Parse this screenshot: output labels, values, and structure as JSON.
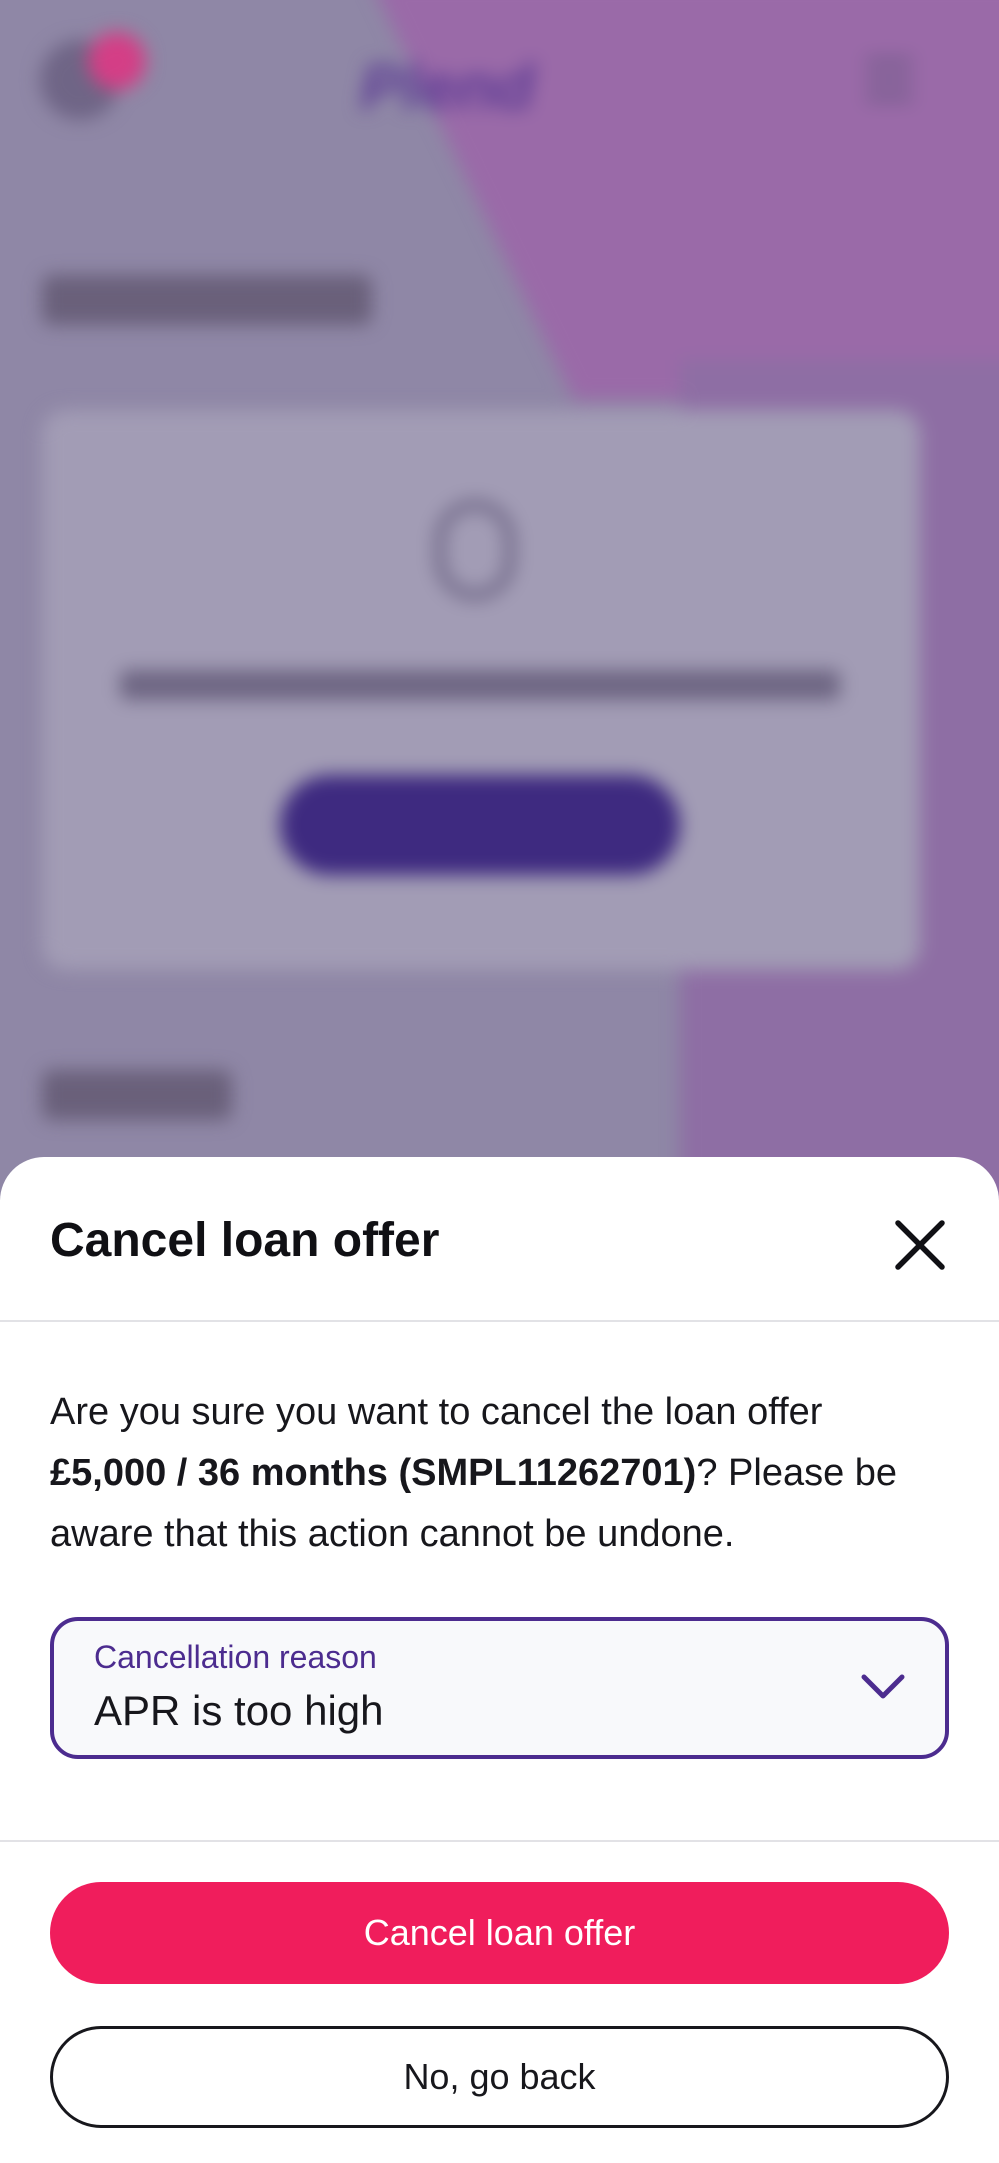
{
  "background": {
    "brand_name": "Plend"
  },
  "sheet": {
    "title": "Cancel loan offer",
    "close_icon": "close-icon",
    "message_prefix": "Are you sure you want to cancel the loan offer ",
    "message_bold": "£5,000 / 36 months (SMPL11262701)",
    "message_suffix": "? Please be aware that this action cannot be undone.",
    "reason_field": {
      "label": "Cancellation reason",
      "value": "APR is too high",
      "icon": "chevron-down-icon"
    },
    "primary_button": "Cancel loan offer",
    "secondary_button": "No, go back"
  },
  "colors": {
    "accent_purple": "#4c2c8f",
    "primary_pink": "#f01d5c",
    "text_dark": "#17171c"
  }
}
